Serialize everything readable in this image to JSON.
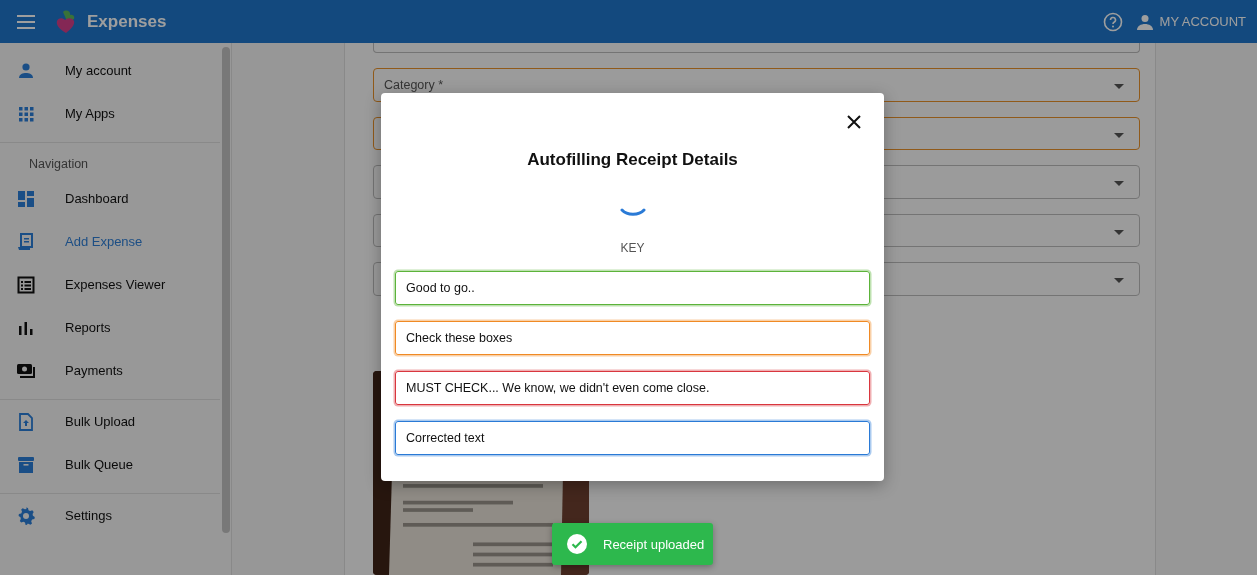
{
  "header": {
    "title": "Expenses",
    "account_label": "MY ACCOUNT"
  },
  "sidebar": {
    "top_items": [
      {
        "label": "My account",
        "selected": false
      },
      {
        "label": "My Apps",
        "selected": false
      }
    ],
    "section_title": "Navigation",
    "nav_items": [
      {
        "label": "Dashboard",
        "selected": false
      },
      {
        "label": "Add Expense",
        "selected": true
      },
      {
        "label": "Expenses Viewer",
        "selected": false
      },
      {
        "label": "Reports",
        "selected": false
      },
      {
        "label": "Payments",
        "selected": false
      }
    ],
    "bulk_items": [
      {
        "label": "Bulk Upload",
        "selected": false
      },
      {
        "label": "Bulk Queue",
        "selected": false
      }
    ],
    "bottom_items": [
      {
        "label": "Settings",
        "selected": false
      }
    ]
  },
  "form": {
    "fields": [
      {
        "invalid": false
      },
      {
        "label": "Category *",
        "invalid": true
      },
      {
        "invalid": true
      },
      {
        "invalid": false
      },
      {
        "invalid": false
      },
      {
        "invalid": false
      }
    ]
  },
  "modal": {
    "title": "Autofilling Receipt Details",
    "key_label": "KEY",
    "key_items": [
      {
        "text": "Good to go..",
        "color": "#5cb33a"
      },
      {
        "text": "Check these boxes",
        "color": "#f08a24"
      },
      {
        "text": "MUST CHECK... We know, we didn't even come close.",
        "color": "#d9363e"
      },
      {
        "text": "Corrected text",
        "color": "#2a7ad6"
      }
    ]
  },
  "toast": {
    "text": "Receipt uploaded"
  }
}
